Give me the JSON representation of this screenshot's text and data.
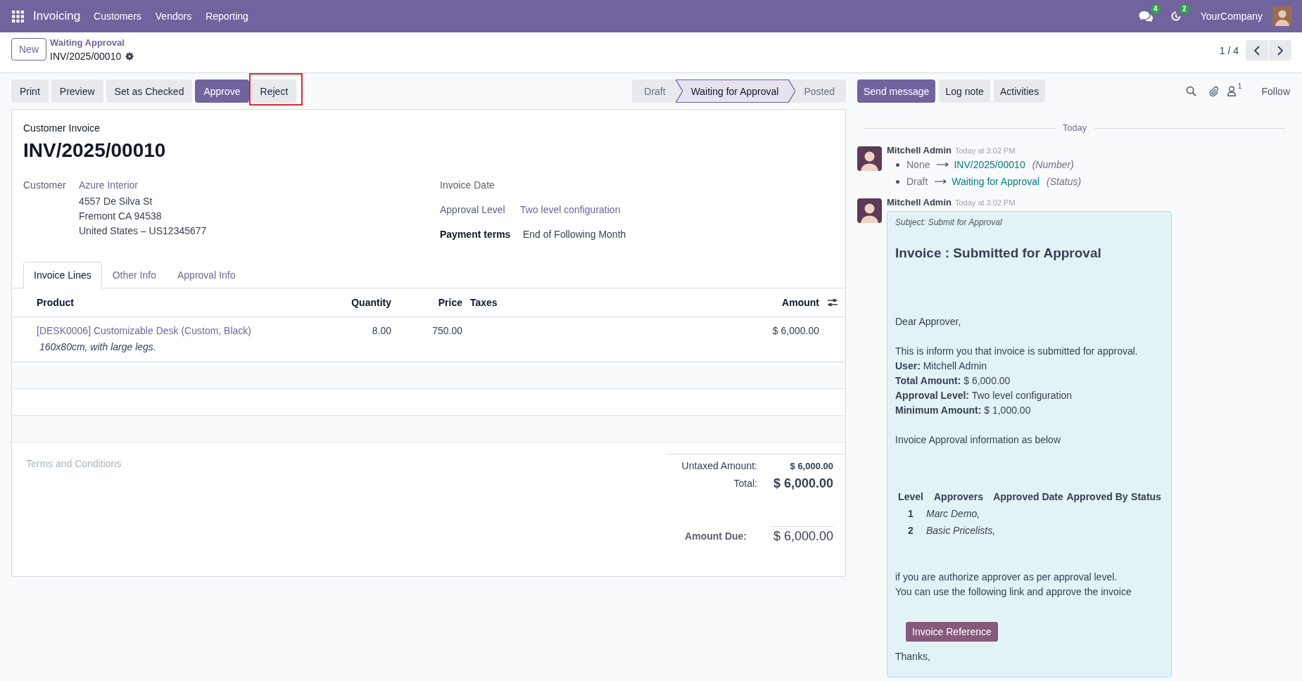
{
  "navbar": {
    "app_name": "Invoicing",
    "menus": [
      "Customers",
      "Vendors",
      "Reporting"
    ],
    "messages_count": "4",
    "activities_count": "2",
    "company": "YourCompany"
  },
  "control_panel": {
    "new_button": "New",
    "breadcrumb": "Waiting Approval",
    "record_name": "INV/2025/00010",
    "pager": "1 / 4"
  },
  "actions": [
    {
      "label": "Print",
      "kind": "secondary",
      "highlighted": false
    },
    {
      "label": "Preview",
      "kind": "secondary",
      "highlighted": false
    },
    {
      "label": "Set as Checked",
      "kind": "secondary",
      "highlighted": false
    },
    {
      "label": "Approve",
      "kind": "primary",
      "highlighted": false
    },
    {
      "label": "Reject",
      "kind": "secondary",
      "highlighted": true
    }
  ],
  "statusbar": [
    {
      "label": "Draft",
      "selected": false
    },
    {
      "label": "Waiting for Approval",
      "selected": true
    },
    {
      "label": "Posted",
      "selected": false
    }
  ],
  "form": {
    "document_type": "Customer Invoice",
    "number": "INV/2025/00010",
    "customer": {
      "label": "Customer",
      "name": "Azure Interior",
      "address": [
        "4557 De Silva St",
        "Fremont CA 94538",
        "United States – US12345677"
      ]
    },
    "fields": [
      {
        "label": "Invoice Date",
        "strong": false
      },
      {
        "label": "Approval Level",
        "value": "Two level configuration",
        "kind": "link",
        "strong": false
      },
      {
        "label": "Payment terms",
        "value": "End of Following Month",
        "kind": "text",
        "strong": true
      }
    ],
    "tabs": [
      {
        "label": "Invoice Lines",
        "selected": true
      },
      {
        "label": "Other Info",
        "selected": false
      },
      {
        "label": "Approval Info",
        "selected": false
      }
    ],
    "table": {
      "columns": [
        "Product",
        "Quantity",
        "Price",
        "Taxes",
        "Amount"
      ],
      "rows": [
        {
          "product": "[DESK0006] Customizable Desk (Custom, Black)",
          "description": "160x80cm, with large legs.",
          "quantity": "8.00",
          "price": "750.00",
          "amount": "$ 6,000.00"
        }
      ]
    },
    "terms": {
      "placeholder": "Terms and Conditions"
    },
    "totals": [
      {
        "label": "Untaxed Amount:",
        "value": "$ 6,000.00",
        "kind": "subtotal"
      },
      {
        "label": "Total:",
        "value": "$ 6,000.00",
        "kind": "total"
      },
      {
        "label": "Amount Due:",
        "value": "$ 6,000.00",
        "kind": "due"
      }
    ]
  },
  "chatter": {
    "buttons": [
      {
        "label": "Send message",
        "kind": "primary"
      },
      {
        "label": "Log note",
        "kind": "secondary"
      },
      {
        "label": "Activities",
        "kind": "secondary"
      }
    ],
    "followers_count": "1",
    "follow": "Follow",
    "date_separator": "Today",
    "messages": [
      {
        "author": "Mitchell Admin",
        "time": "Today at 3:02 PM",
        "kind": "tracking",
        "changes": [
          {
            "old": "None",
            "new": "INV/2025/00010",
            "field": "(Number)"
          },
          {
            "old": "Draft",
            "new": "Waiting for Approval",
            "field": "(Status)"
          }
        ]
      },
      {
        "author": "Mitchell Admin",
        "time": "Today at 3:02 PM",
        "kind": "email",
        "email": {
          "subject": "Subject: Submit for Approval",
          "heading": "Invoice : Submitted for Approval",
          "greeting": "Dear Approver,",
          "intro": "This is inform you that invoice is submitted for approval.",
          "details": [
            "**User:** Mitchell Admin",
            "**Total Amount:** $ 6,000.00",
            "**Approval Level:** Two level configuration",
            "**Minimum Amount:** $ 1,000.00"
          ],
          "info": "Invoice Approval information as below",
          "approval_table": {
            "columns": [
              "Level",
              "Approvers",
              "Approved Date",
              "Approved By",
              "Status"
            ],
            "rows": [
              {
                "level": "1",
                "approvers": "Marc Demo,"
              },
              {
                "level": "2",
                "approvers": "Basic Pricelists,"
              }
            ]
          },
          "closing": [
            "if you are authorize approver as per approval level.",
            "You can use the following link and approve the invoice"
          ],
          "button": "Invoice Reference",
          "signoff": "Thanks,"
        }
      }
    ]
  }
}
